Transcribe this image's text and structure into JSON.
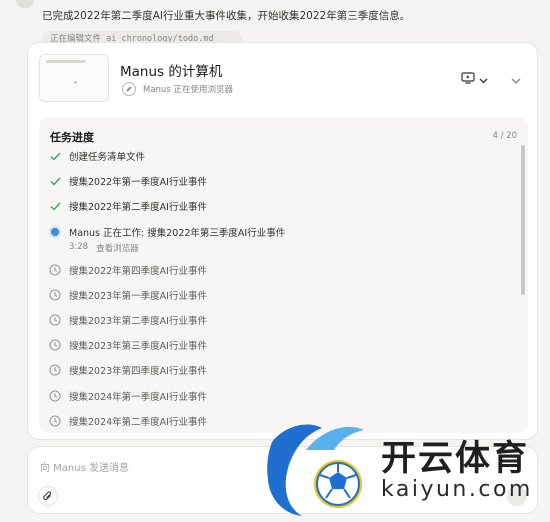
{
  "status_message": "已完成2022年第二季度AI行业重大事件收集，开始收集2022年第三季度信息。",
  "file_chip": "正在编辑文件 ai_chronology/todo.md",
  "computer": {
    "title": "Manus 的计算机",
    "subtitle": "Manus 正在使用浏览器",
    "icons": {
      "app": "compass-icon",
      "view": "monitor-icon",
      "toggle": "chevron-down-icon"
    }
  },
  "progress": {
    "title": "任务进度",
    "count": "4 / 20",
    "done": [
      "创建任务清单文件",
      "搜集2022年第一季度AI行业事件",
      "搜集2022年第二季度AI行业事件"
    ],
    "current": {
      "label": "Manus 正在工作: 搜集2022年第三季度AI行业事件",
      "time": "3:28",
      "action": "查看浏览器"
    },
    "pending": [
      "搜集2022年第四季度AI行业事件",
      "搜集2023年第一季度AI行业事件",
      "搜集2023年第二季度AI行业事件",
      "搜集2023年第三季度AI行业事件",
      "搜集2023年第四季度AI行业事件",
      "搜集2024年第一季度AI行业事件",
      "搜集2024年第二季度AI行业事件"
    ]
  },
  "composer": {
    "placeholder": "向 Manus 发送消息"
  },
  "watermark": {
    "cn": "开云体育",
    "en": "kaiyun.com"
  },
  "colors": {
    "check": "#3aa36c",
    "current": "#3d8bd9",
    "accent_blue": "#1e6fd0",
    "ball_yellow": "#f2c21b"
  }
}
